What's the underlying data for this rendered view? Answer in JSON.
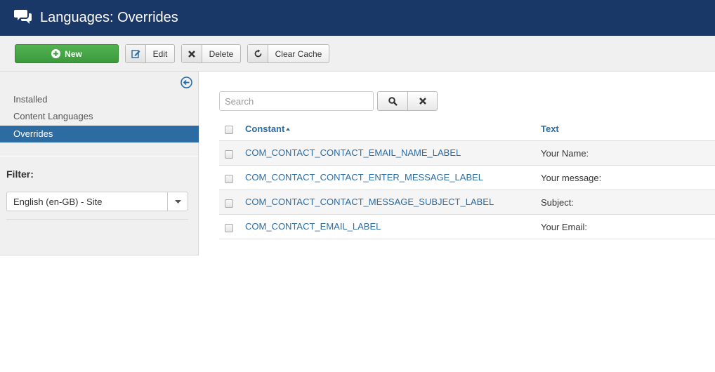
{
  "header": {
    "title": "Languages: Overrides",
    "icon": "comments-icon"
  },
  "toolbar": {
    "new_label": "New",
    "edit_label": "Edit",
    "delete_label": "Delete",
    "clear_cache_label": "Clear Cache"
  },
  "sidebar": {
    "items": [
      {
        "label": "Installed",
        "active": false
      },
      {
        "label": "Content Languages",
        "active": false
      },
      {
        "label": "Overrides",
        "active": true
      }
    ],
    "filter_label": "Filter:",
    "filter_value": "English (en-GB) - Site"
  },
  "search": {
    "placeholder": "Search",
    "value": ""
  },
  "table": {
    "columns": {
      "constant": "Constant",
      "text": "Text"
    },
    "rows": [
      {
        "constant": "COM_CONTACT_CONTACT_EMAIL_NAME_LABEL",
        "text": "Your Name:"
      },
      {
        "constant": "COM_CONTACT_CONTACT_ENTER_MESSAGE_LABEL",
        "text": "Your message:"
      },
      {
        "constant": "COM_CONTACT_CONTACT_MESSAGE_SUBJECT_LABEL",
        "text": "Subject:"
      },
      {
        "constant": "COM_CONTACT_EMAIL_LABEL",
        "text": "Your Email:"
      }
    ]
  },
  "colors": {
    "header_bg": "#1a3867",
    "accent": "#2d6ca2",
    "new_button": "#46a546",
    "link": "#2b6ca3"
  }
}
